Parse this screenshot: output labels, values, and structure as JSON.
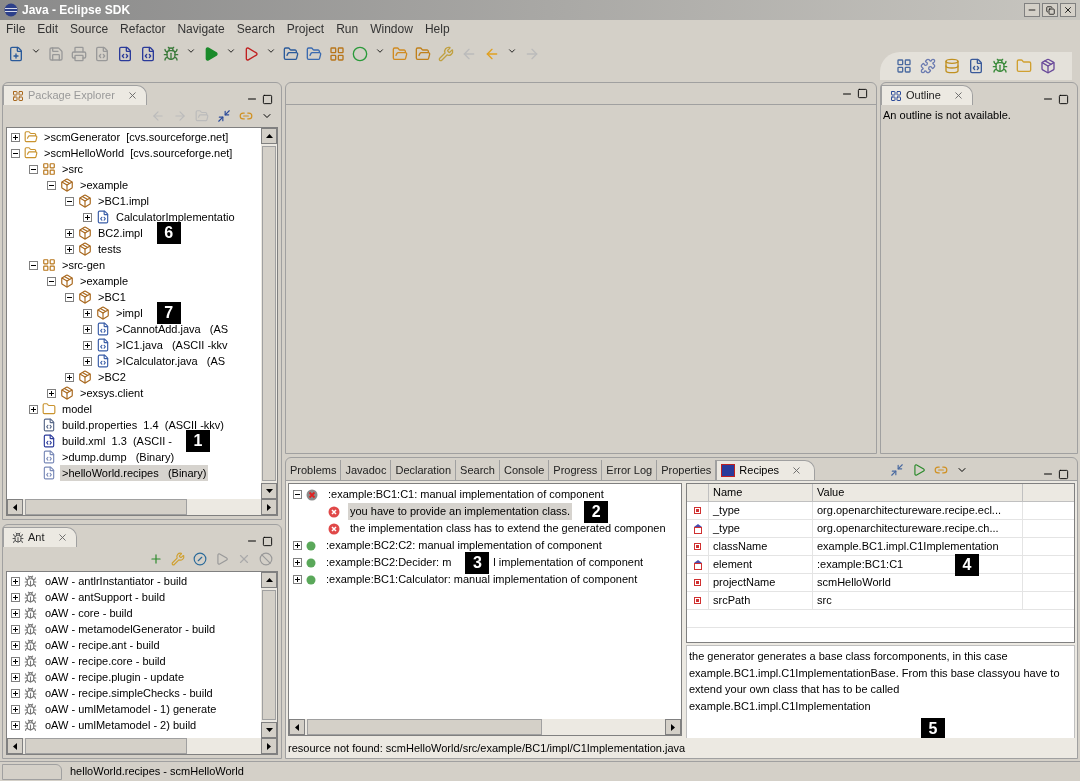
{
  "window": {
    "title": "Java - Eclipse SDK"
  },
  "menu": [
    "File",
    "Edit",
    "Source",
    "Refactor",
    "Navigate",
    "Search",
    "Project",
    "Run",
    "Window",
    "Help"
  ],
  "package_explorer": {
    "title": "Package Explorer",
    "items": [
      {
        "kind": "project",
        "label": ">scmGenerator  [cvs.sourceforge.net]",
        "expanded": false,
        "selected": false
      },
      {
        "kind": "project",
        "label": ">scmHelloWorld  [cvs.sourceforge.net]",
        "expanded": true,
        "selected": false,
        "children": [
          {
            "kind": "source_folder",
            "label": ">src",
            "expanded": true,
            "selected": false,
            "children": [
              {
                "kind": "package",
                "label": ">example",
                "expanded": true,
                "selected": false,
                "children": [
                  {
                    "kind": "package",
                    "label": ">BC1.impl",
                    "expanded": true,
                    "selected": false,
                    "children": [
                      {
                        "kind": "java",
                        "label": "CalculatorImplementatio",
                        "expanded": false,
                        "selected": false
                      }
                    ]
                  },
                  {
                    "kind": "package",
                    "label": "BC2.impl",
                    "expanded": false,
                    "selected": false,
                    "callout": "6"
                  },
                  {
                    "kind": "package",
                    "label": "tests",
                    "expanded": false,
                    "selected": false
                  }
                ]
              }
            ]
          },
          {
            "kind": "source_folder",
            "label": ">src-gen",
            "expanded": true,
            "selected": false,
            "children": [
              {
                "kind": "package",
                "label": ">example",
                "expanded": true,
                "selected": false,
                "children": [
                  {
                    "kind": "package",
                    "label": ">BC1",
                    "expanded": true,
                    "selected": false,
                    "children": [
                      {
                        "kind": "package",
                        "label": ">impl",
                        "expanded": false,
                        "selected": false,
                        "callout": "7"
                      },
                      {
                        "kind": "java",
                        "label": ">CannotAdd.java   (AS",
                        "expanded": false,
                        "selected": false
                      },
                      {
                        "kind": "java",
                        "label": ">IC1.java   (ASCII -kkv",
                        "expanded": false,
                        "selected": false
                      },
                      {
                        "kind": "java",
                        "label": ">ICalculator.java   (AS",
                        "expanded": false,
                        "selected": false
                      }
                    ]
                  },
                  {
                    "kind": "package",
                    "label": ">BC2",
                    "expanded": false,
                    "selected": false
                  }
                ]
              },
              {
                "kind": "package",
                "label": ">exsys.client",
                "expanded": false,
                "selected": false
              }
            ]
          },
          {
            "kind": "folder",
            "label": "model",
            "expanded": false,
            "selected": false
          },
          {
            "kind": "properties",
            "label": "build.properties  1.4  (ASCII -kkv)",
            "selected": false
          },
          {
            "kind": "xml",
            "label": "build.xml  1.3  (ASCII -",
            "selected": false,
            "callout": "1"
          },
          {
            "kind": "file",
            "label": ">dump.dump   (Binary)",
            "selected": false
          },
          {
            "kind": "file",
            "label": ">helloWorld.recipes   (Binary)",
            "selected": true
          }
        ]
      }
    ]
  },
  "outline": {
    "title": "Outline",
    "message": "An outline is not available."
  },
  "ant": {
    "title": "Ant",
    "items": [
      {
        "label": "oAW - antlrInstantiator - build"
      },
      {
        "label": "oAW - antSupport - build"
      },
      {
        "label": "oAW - core - build"
      },
      {
        "label": "oAW - metamodelGenerator - build"
      },
      {
        "label": "oAW - recipe.ant - build"
      },
      {
        "label": "oAW - recipe.core - build"
      },
      {
        "label": "oAW - recipe.plugin - update"
      },
      {
        "label": "oAW - recipe.simpleChecks - build"
      },
      {
        "label": "oAW - umlMetamodel - 1) generate"
      },
      {
        "label": "oAW - umlMetamodel - 2) build"
      }
    ]
  },
  "bottom_panel": {
    "tabs": [
      {
        "label": "Problems",
        "selected": false
      },
      {
        "label": "Javadoc",
        "selected": false
      },
      {
        "label": "Declaration",
        "selected": false
      },
      {
        "label": "Search",
        "selected": false
      },
      {
        "label": "Console",
        "selected": false
      },
      {
        "label": "Progress",
        "selected": false
      },
      {
        "label": "Error Log",
        "selected": false
      },
      {
        "label": "Properties",
        "selected": false
      },
      {
        "label": "Recipes",
        "selected": true
      }
    ],
    "recipes": [
      {
        "kind": "failed",
        "label": ":example:BC1:C1: manual implementation of component",
        "expanded": true,
        "selected": false,
        "children": [
          {
            "kind": "error",
            "label": "you have to provide an implementation class.",
            "selected": true,
            "callout": "2"
          },
          {
            "kind": "error",
            "label": "the implementation class has to extend the generated componen",
            "selected": false
          }
        ]
      },
      {
        "kind": "ok",
        "label": ":example:BC2:C2: manual implementation of component",
        "expanded": false,
        "selected": false
      },
      {
        "kind": "ok",
        "label": ":example:BC2:Decider: m",
        "callout": "3",
        "label_after": "l implementation of component",
        "expanded": false,
        "selected": false
      },
      {
        "kind": "ok",
        "label": ":example:BC1:Calculator: manual implementation of component",
        "expanded": false,
        "selected": false
      }
    ],
    "properties": {
      "columns": [
        "Name",
        "Value"
      ],
      "rows": [
        {
          "kind": "attribute",
          "name": "_type",
          "value": "org.openarchitectureware.recipe.ecl..."
        },
        {
          "kind": "reference",
          "name": "_type",
          "value": "org.openarchitectureware.recipe.ch..."
        },
        {
          "kind": "attribute",
          "name": "className",
          "value": "example.BC1.impl.C1Implementation"
        },
        {
          "kind": "reference",
          "name": "element",
          "value": ":example:BC1:C1",
          "callout": "4"
        },
        {
          "kind": "attribute",
          "name": "projectName",
          "value": "scmHelloWorld"
        },
        {
          "kind": "attribute",
          "name": "srcPath",
          "value": "src"
        }
      ]
    },
    "description": "the generator generates a base class forcomponents, in this case example.BC1.impl.C1ImplementationBase. From this base classyou have to extend your own class that has to be called example.BC1.impl.C1Implementation",
    "description_callout": "5",
    "status": "resource not found: scmHelloWorld/src/example/BC1/impl/C1Implementation.java"
  },
  "status_bar": {
    "text": "helloWorld.recipes - scmHelloWorld"
  }
}
